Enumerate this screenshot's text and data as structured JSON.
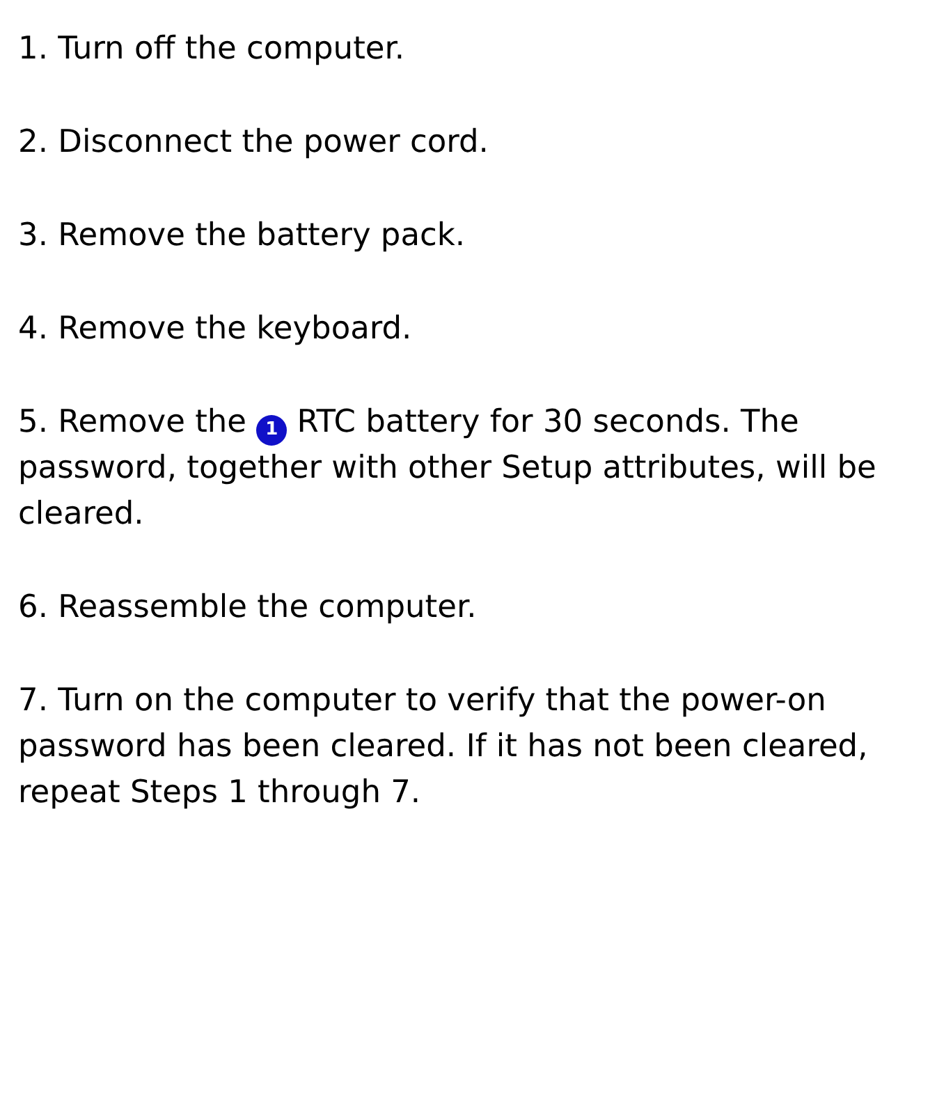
{
  "steps": [
    {
      "kind": "plain",
      "text": "1. Turn off the computer."
    },
    {
      "kind": "plain",
      "text": "2. Disconnect the power cord."
    },
    {
      "kind": "plain",
      "text": "3. Remove the battery pack."
    },
    {
      "kind": "plain",
      "text": "4. Remove the keyboard."
    },
    {
      "kind": "callout",
      "text_before": "5. Remove the",
      "callout": "1",
      "text_after": "RTC battery for 30 seconds. The password, together with other Setup attributes, will be cleared."
    },
    {
      "kind": "plain",
      "text": "6. Reassemble the computer."
    },
    {
      "kind": "plain",
      "text": "7. Turn on the computer to verify that the power-on password has been cleared. If it has not been cleared, repeat Steps 1 through 7."
    }
  ]
}
